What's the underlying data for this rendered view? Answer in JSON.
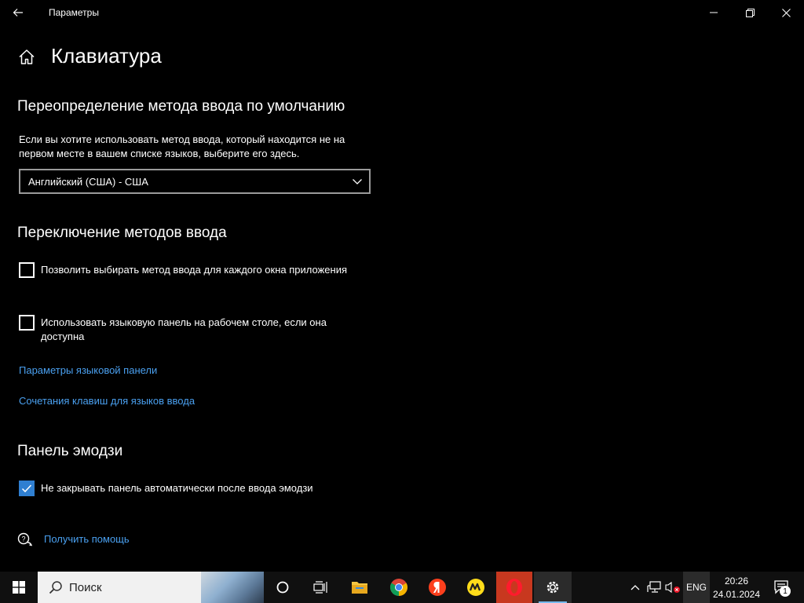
{
  "window": {
    "title": "Параметры",
    "back_icon": "back-arrow-icon",
    "minimize_icon": "minimize-icon",
    "restore_icon": "restore-icon",
    "close_icon": "close-icon"
  },
  "page": {
    "title": "Клавиатура",
    "home_icon": "home-icon"
  },
  "override": {
    "heading": "Переопределение метода ввода по умолчанию",
    "description": "Если вы хотите использовать метод ввода, который находится не на первом месте в вашем списке языков, выберите его здесь.",
    "dropdown_value": "Английский (США) - США"
  },
  "switching": {
    "heading": "Переключение методов ввода",
    "option1_label": "Позволить выбирать метод ввода для каждого окна приложения",
    "option1_checked": false,
    "option2_label": "Использовать языковую панель на рабочем столе, если она доступна",
    "option2_checked": false,
    "link1": "Параметры языковой панели",
    "link2": "Сочетания клавиш для языков ввода"
  },
  "emoji": {
    "heading": "Панель эмодзи",
    "option_label": "Не закрывать панель автоматически после ввода эмодзи",
    "option_checked": true
  },
  "help": {
    "link": "Получить помощь",
    "icon": "help-chat-icon"
  },
  "taskbar": {
    "search_placeholder": "Поиск",
    "apps": [
      "start-icon",
      "cortana-icon",
      "task-view-icon",
      "file-explorer-icon",
      "chrome-icon",
      "yandex-browser-icon",
      "yandex-market-icon",
      "opera-icon",
      "settings-icon"
    ],
    "lang": "ENG",
    "time": "20:26",
    "date": "24.01.2024",
    "notification_count": "1",
    "colors": {
      "accent": "#2f7fd1",
      "link": "#4aa0f0",
      "opera": "#c8381f"
    }
  }
}
